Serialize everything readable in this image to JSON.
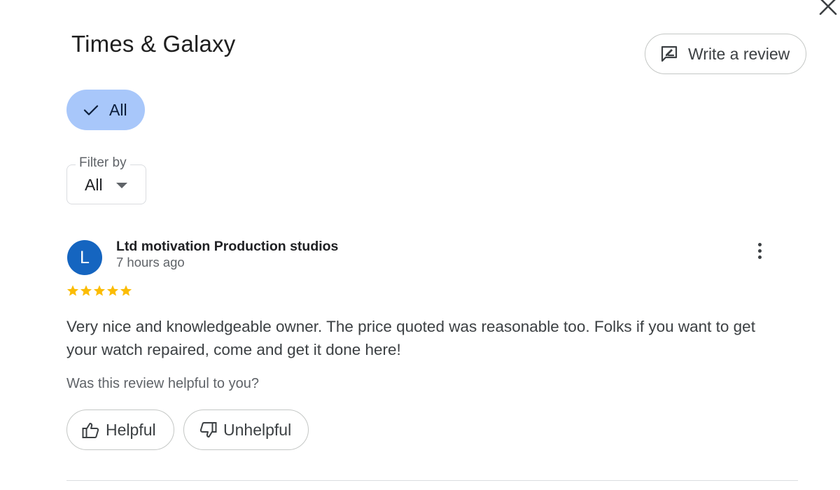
{
  "header": {
    "title": "Times & Galaxy",
    "write_review_label": "Write a review",
    "close_icon": "close-icon"
  },
  "chips": {
    "all_label": "All",
    "selected": true
  },
  "filter": {
    "legend": "Filter by",
    "selected_value": "All"
  },
  "review": {
    "avatar_letter": "L",
    "avatar_color": "#1565c0",
    "author": "Ltd motivation Production studios",
    "time": "7 hours ago",
    "rating": 5,
    "rating_max": 5,
    "star_color": "#fbbc04",
    "text": "Very nice and knowledgeable owner. The price quoted was reasonable too. Folks if you want to get your watch repaired, come and get it done here!",
    "helpful_question": "Was this review helpful to you?",
    "helpful_label": "Helpful",
    "unhelpful_label": "Unhelpful"
  },
  "colors": {
    "chip_selected_bg": "#a8c7fa",
    "border": "#c4c7c5"
  }
}
